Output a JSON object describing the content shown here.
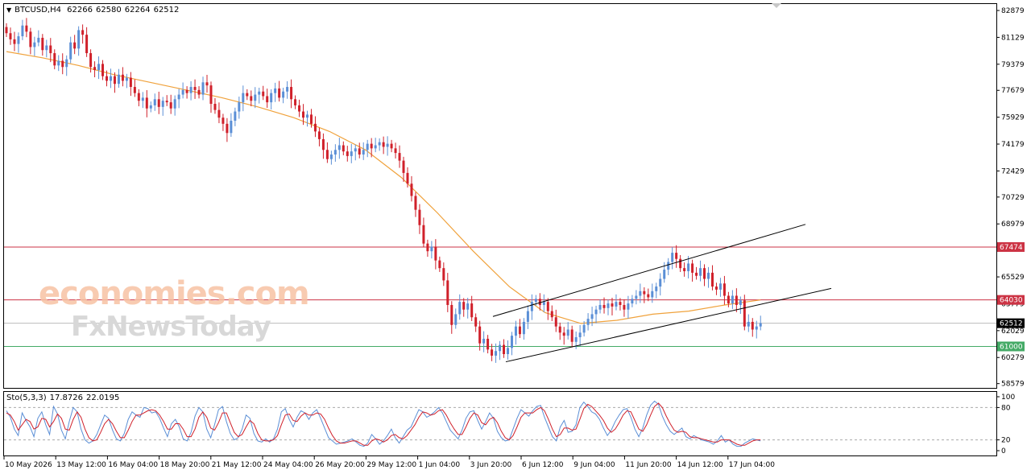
{
  "header": {
    "symbol": "BTCUSD,H4",
    "open": "62266",
    "high": "62580",
    "low": "62264",
    "close": "62512",
    "indicator": "Sto(5,3,3)",
    "k_value": "17.8726",
    "d_value": "22.0195"
  },
  "watermark": {
    "line1": "economies.com",
    "line2": "FxNewsToday"
  },
  "colors": {
    "bull": "#5b8fd6",
    "bear": "#d0202a",
    "ma": "#f0a23c",
    "resistance": "#cc3344",
    "support": "#44aa66",
    "current": "#000000",
    "stoch_main": "#5b8fd6",
    "stoch_signal": "#d0202a"
  },
  "chart_data": {
    "type": "candlestick",
    "price_axis": {
      "labels": [
        "82879",
        "81129",
        "79379",
        "77679",
        "75929",
        "74179",
        "72429",
        "70729",
        "68979",
        "65529",
        "63779",
        "62029",
        "60279",
        "58579"
      ],
      "values": [
        82879,
        81129,
        79379,
        77679,
        75929,
        74179,
        72429,
        70729,
        68979,
        65529,
        63779,
        62029,
        60279,
        58579
      ],
      "range": [
        58300,
        83300
      ]
    },
    "time_axis": {
      "labels": [
        "10 May 2026",
        "13 May 12:00",
        "16 May 04:00",
        "18 May 20:00",
        "21 May 12:00",
        "24 May 04:00",
        "26 May 20:00",
        "29 May 12:00",
        "1 Jun 04:00",
        "3 Jun 20:00",
        "6 Jun 12:00",
        "9 Jun 04:00",
        "11 Jun 20:00",
        "14 Jun 12:00",
        "17 Jun 04:00"
      ]
    },
    "levels": [
      {
        "label": "67474",
        "value": 67474,
        "kind": "resistance"
      },
      {
        "label": "64030",
        "value": 64030,
        "kind": "resistance"
      },
      {
        "label": "61000",
        "value": 61000,
        "kind": "support"
      }
    ],
    "current_price": {
      "label": "62512",
      "value": 62512
    },
    "channel": {
      "lower": [
        [
          628,
          60000
        ],
        [
          1032,
          64780
        ]
      ],
      "upper": [
        [
          612,
          62950
        ],
        [
          1000,
          68950
        ]
      ]
    },
    "closes": [
      81400,
      81000,
      80700,
      81200,
      81900,
      81500,
      80500,
      80800,
      81100,
      80300,
      80600,
      80100,
      79300,
      79600,
      79200,
      79700,
      80800,
      80400,
      81600,
      81300,
      80100,
      79200,
      79000,
      79400,
      78600,
      78300,
      78600,
      78100,
      78700,
      78300,
      78500,
      77900,
      77500,
      77000,
      77200,
      76500,
      76700,
      77100,
      76600,
      77000,
      76900,
      76500,
      77100,
      77400,
      77700,
      77500,
      77900,
      77700,
      77400,
      78200,
      78000,
      76800,
      76400,
      75900,
      75500,
      74900,
      75700,
      76300,
      76900,
      77500,
      77300,
      77000,
      77400,
      77600,
      77300,
      76900,
      77500,
      77800,
      77200,
      77600,
      77900,
      77100,
      76700,
      76300,
      75900,
      76100,
      75500,
      75000,
      74500,
      73800,
      73200,
      73500,
      73800,
      74100,
      73700,
      73400,
      73700,
      73900,
      73500,
      73800,
      74200,
      73900,
      74100,
      74300,
      74000,
      74200,
      73900,
      73600,
      73100,
      72300,
      71600,
      70800,
      69900,
      68900,
      67700,
      67200,
      67500,
      66600,
      66100,
      65300,
      63700,
      62400,
      63100,
      63900,
      63400,
      63800,
      62900,
      62300,
      61200,
      61500,
      60800,
      60400,
      60700,
      61100,
      60500,
      60900,
      61700,
      62300,
      61800,
      62600,
      63300,
      63900,
      64100,
      63700,
      63900,
      63300,
      62900,
      62300,
      61900,
      61700,
      62100,
      61300,
      61600,
      61900,
      62400,
      62800,
      63100,
      63400,
      63700,
      63500,
      63800,
      63600,
      63900,
      63700,
      63400,
      63800,
      64100,
      64300,
      64600,
      64400,
      64200,
      64600,
      64900,
      65400,
      66000,
      66500,
      67100,
      66700,
      66100,
      65900,
      66400,
      65800,
      65600,
      66100,
      65400,
      65800,
      64900,
      64700,
      65100,
      64300,
      63800,
      64300,
      63700,
      64000,
      62300,
      62600,
      62100,
      62300,
      62512
    ],
    "ma": [
      80200,
      79800,
      79300,
      78700,
      78200,
      77700,
      77200,
      76600,
      75900,
      75000,
      73800,
      72000,
      69700,
      67200,
      64900,
      63200,
      62500,
      62700,
      63100,
      63300,
      63700,
      64030
    ],
    "stochastic": {
      "levels": [
        100,
        80,
        20,
        0
      ],
      "k": [
        74,
        62,
        40,
        28,
        70,
        56,
        44,
        26,
        60,
        72,
        48,
        30,
        82,
        68,
        38,
        22,
        54,
        80,
        72,
        40,
        20,
        14,
        18,
        30,
        48,
        66,
        60,
        38,
        22,
        18,
        32,
        58,
        72,
        66,
        62,
        80,
        78,
        70,
        72,
        60,
        42,
        26,
        50,
        58,
        44,
        22,
        18,
        34,
        64,
        80,
        72,
        40,
        24,
        48,
        76,
        82,
        54,
        32,
        20,
        24,
        40,
        66,
        60,
        32,
        18,
        16,
        22,
        16,
        22,
        40,
        72,
        78,
        58,
        44,
        62,
        74,
        70,
        58,
        70,
        76,
        60,
        42,
        24,
        18,
        12,
        14,
        16,
        18,
        22,
        16,
        10,
        8,
        14,
        30,
        22,
        12,
        18,
        28,
        40,
        24,
        14,
        26,
        38,
        44,
        60,
        76,
        72,
        62,
        66,
        72,
        80,
        70,
        54,
        38,
        30,
        22,
        38,
        60,
        72,
        74,
        56,
        40,
        54,
        70,
        60,
        36,
        24,
        18,
        20,
        40,
        60,
        76,
        70,
        64,
        74,
        82,
        84,
        62,
        44,
        26,
        18,
        44,
        56,
        34,
        36,
        48,
        80,
        90,
        82,
        72,
        68,
        58,
        42,
        28,
        38,
        54,
        66,
        76,
        78,
        62,
        40,
        26,
        42,
        66,
        84,
        92,
        86,
        64,
        48,
        36,
        30,
        36,
        42,
        26,
        22,
        28,
        24,
        20,
        18,
        16,
        12,
        18,
        28,
        16,
        20,
        12,
        8,
        8,
        14,
        18,
        22,
        20,
        18
      ],
      "d": [
        70,
        66,
        54,
        38,
        48,
        58,
        54,
        40,
        44,
        60,
        58,
        44,
        54,
        68,
        60,
        40,
        38,
        58,
        72,
        62,
        40,
        24,
        18,
        20,
        34,
        50,
        58,
        50,
        36,
        24,
        24,
        38,
        54,
        66,
        66,
        70,
        74,
        76,
        74,
        66,
        54,
        40,
        40,
        50,
        50,
        40,
        26,
        26,
        40,
        62,
        72,
        62,
        42,
        38,
        52,
        70,
        70,
        52,
        34,
        26,
        30,
        44,
        56,
        50,
        32,
        20,
        18,
        18,
        20,
        28,
        48,
        66,
        68,
        56,
        54,
        64,
        70,
        66,
        66,
        70,
        68,
        58,
        42,
        28,
        18,
        14,
        14,
        16,
        18,
        18,
        14,
        10,
        10,
        18,
        22,
        20,
        16,
        20,
        28,
        30,
        24,
        22,
        28,
        38,
        48,
        62,
        72,
        70,
        66,
        68,
        74,
        76,
        66,
        52,
        40,
        30,
        30,
        44,
        60,
        70,
        66,
        52,
        48,
        58,
        62,
        52,
        36,
        24,
        20,
        28,
        44,
        62,
        70,
        70,
        70,
        76,
        80,
        74,
        58,
        40,
        26,
        30,
        42,
        42,
        38,
        40,
        58,
        78,
        86,
        82,
        74,
        66,
        56,
        42,
        34,
        40,
        52,
        66,
        74,
        72,
        56,
        40,
        36,
        48,
        66,
        82,
        88,
        80,
        64,
        50,
        38,
        34,
        36,
        34,
        26,
        24,
        24,
        22,
        20,
        18,
        16,
        16,
        20,
        20,
        20,
        16,
        12,
        10,
        10,
        14,
        18,
        20,
        20
      ]
    }
  }
}
